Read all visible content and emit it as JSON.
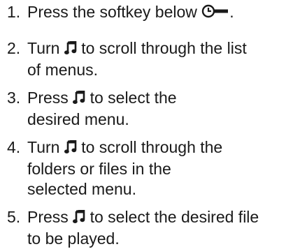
{
  "steps": [
    {
      "number": "1.",
      "lines": [
        {
          "before": "Press the softkey below ",
          "icon": "clock-softkey-icon",
          "after": "."
        }
      ]
    },
    {
      "number": "2.",
      "lines": [
        {
          "before": "Turn ",
          "icon": "music-note-knob-icon",
          "after": " to scroll through the list"
        },
        {
          "text": "of menus."
        }
      ]
    },
    {
      "number": "3.",
      "lines": [
        {
          "before": "Press ",
          "icon": "music-note-knob-icon",
          "after": " to select the"
        },
        {
          "text": "desired menu."
        }
      ]
    },
    {
      "number": "4.",
      "lines": [
        {
          "before": "Turn ",
          "icon": "music-note-knob-icon",
          "after": " to scroll through the"
        },
        {
          "text": "folders or files in the"
        },
        {
          "text": "selected menu."
        }
      ]
    },
    {
      "number": "5.",
      "lines": [
        {
          "before": "Press ",
          "icon": "music-note-knob-icon",
          "after": " to select the desired file"
        },
        {
          "text": "to be played."
        }
      ]
    }
  ],
  "colors": {
    "text": "#1a1a1a",
    "background": "#ffffff"
  }
}
